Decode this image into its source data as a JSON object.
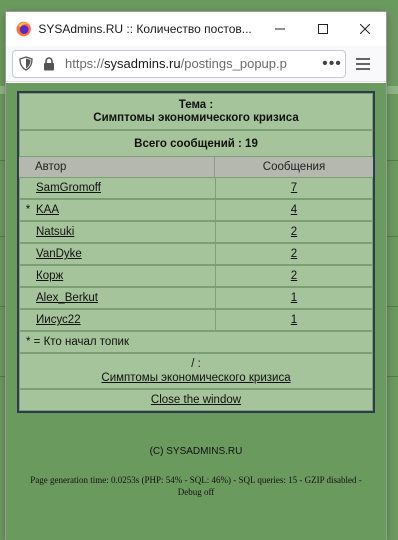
{
  "window": {
    "title": "SYSAdmins.RU :: Количество постов...",
    "url_scheme": "https://",
    "url_host": "sysadmins.ru",
    "url_path": "/postings_popup.p"
  },
  "topic": {
    "label": "Тема :",
    "name": "Симптомы экономического кризиса",
    "total": "Всего сообщений : 19"
  },
  "columns": {
    "author": "Автор",
    "posts": "Сообщения"
  },
  "rows": [
    {
      "star": "",
      "author": "SamGromoff",
      "posts": "7"
    },
    {
      "star": "*",
      "author": "KAA",
      "posts": "4"
    },
    {
      "star": "",
      "author": "Natsuki",
      "posts": "2"
    },
    {
      "star": "",
      "author": "VanDyke",
      "posts": "2"
    },
    {
      "star": "",
      "author": "Корж",
      "posts": "2"
    },
    {
      "star": "",
      "author": "Alex_Berkut",
      "posts": "1"
    },
    {
      "star": "",
      "author": "Иисус22",
      "posts": "1"
    }
  ],
  "legend": "* = Кто начал топик",
  "bottom": {
    "prefix": "/ :",
    "topic_link": "Симптомы экономического кризиса",
    "close": "Close the window"
  },
  "footer": {
    "copyright": "(C) SYSADMINS.RU",
    "generation": "Page generation time: 0.0253s (PHP: 54% - SQL: 46%) - SQL queries: 15 - GZIP disabled - Debug off"
  },
  "colors": {
    "page_bg": "#6b9a5f",
    "table_bg": "#a6c49c",
    "header_bg": "#b4b8ae",
    "table_border": "#2d3b4e"
  }
}
